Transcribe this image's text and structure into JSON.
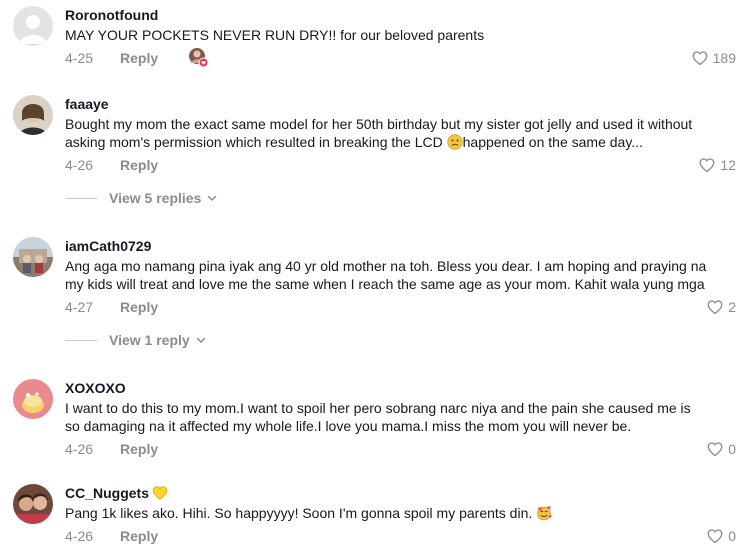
{
  "comments": [
    {
      "username": "Roronotfound",
      "text": "MAY YOUR POCKETS NEVER RUN DRY!! for our beloved parents",
      "date": "4-25",
      "reply_label": "Reply",
      "likes": "189",
      "avatar": "default-avatar",
      "has_creator_badge": true
    },
    {
      "username": "faaaye",
      "text_line1": "Bought my mom the exact same model for her 50th birthday but my sister got jelly and used it without",
      "text_line2_a": "asking mom's permission which resulted in breaking the LCD ",
      "text_line2_emoji": "sad-face-emoji",
      "text_line2_b": "happened on the same day...",
      "date": "4-26",
      "reply_label": "Reply",
      "likes": "12",
      "view_replies": "View 5 replies"
    },
    {
      "username": "iamCath0729",
      "text_line1": "Ang aga mo namang pina iyak ang 40 yr old mother na toh. Bless you dear. I am hoping and praying na",
      "text_line2": "my kids will treat and love me the same when I reach the same age as your mom. Kahit wala yung mga",
      "date": "4-27",
      "reply_label": "Reply",
      "likes": "2",
      "view_replies": "View 1 reply"
    },
    {
      "username": "XOXOXO",
      "text_line1": "I want to do this to my mom.I want to spoil her pero sobrang narc niya and the pain she caused me is",
      "text_line2": "so damaging na it affected my whole life.I love you mama.I miss the mom you will never be.",
      "date": "4-26",
      "reply_label": "Reply",
      "likes": "0"
    },
    {
      "username": "CC_Nuggets",
      "username_emoji": "yellow-heart-emoji",
      "text": "Pang 1k likes ako. Hihi. So happyyyy! Soon I'm gonna spoil my parents din. ",
      "text_emoji": "smiling-hearts-emoji",
      "date": "4-26",
      "reply_label": "Reply",
      "likes": "0"
    }
  ],
  "colors": {
    "text": "#161823",
    "muted": "#8a8b91",
    "divider": "#c7c7cb",
    "badge": "#fe2c55"
  }
}
